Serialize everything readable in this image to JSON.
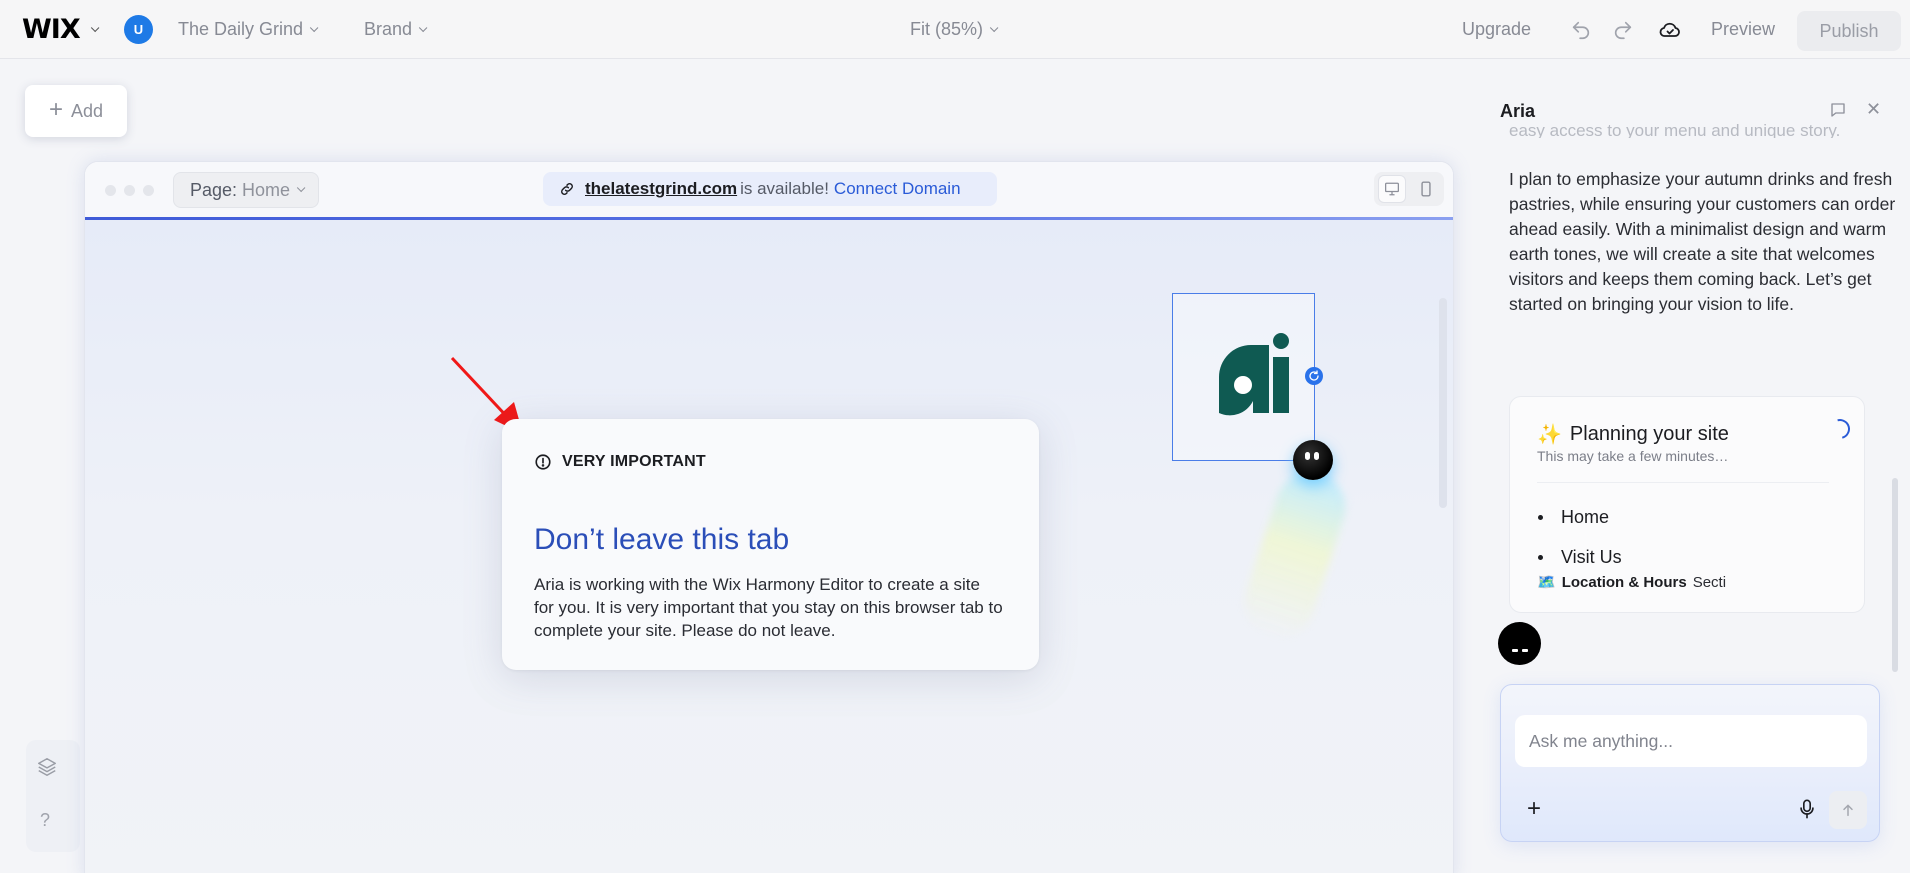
{
  "topbar": {
    "logo": "WIX",
    "avatar_initial": "U",
    "site_name": "The Daily Grind",
    "brand": "Brand",
    "zoom": "Fit (85%)",
    "upgrade": "Upgrade",
    "preview": "Preview",
    "publish": "Publish"
  },
  "add_button": {
    "label": "Add"
  },
  "left_tools": {
    "help": "?"
  },
  "browser": {
    "page_prefix": "Page:",
    "page_value": "Home",
    "domain": "thelatestgrind.com",
    "domain_status": "is available!",
    "connect": "Connect Domain"
  },
  "modal": {
    "tag": "VERY IMPORTANT",
    "title": "Don’t leave this tab",
    "body": "Aria is working with the Wix Harmony Editor to create a site for you. It is very important that you stay on this browser tab to complete your site. Please do not leave."
  },
  "aria": {
    "title": "Aria",
    "faded_text": "easy access to your menu and unique story.",
    "message": "I plan to emphasize your autumn drinks and fresh pastries, while ensuring your customers can order ahead easily. With a minimalist design and warm earth tones, we will create a site that welcomes visitors and keeps them coming back. Let’s get started on bringing your vision to life.",
    "plan": {
      "emoji": "✨",
      "title": "Planning your site",
      "subtitle": "This may take a few minutes…",
      "items": [
        {
          "label": "Home"
        },
        {
          "label": "Visit Us"
        }
      ],
      "section_emoji": "🗺️",
      "section_bold": "Location & Hours",
      "section_rest": "Secti"
    },
    "composer": {
      "placeholder": "Ask me anything..."
    }
  },
  "colors": {
    "accent": "#2a5bd7",
    "modal_title": "#2b4eb8",
    "logo_green": "#0f5a52",
    "arrow_red": "#f01818"
  }
}
